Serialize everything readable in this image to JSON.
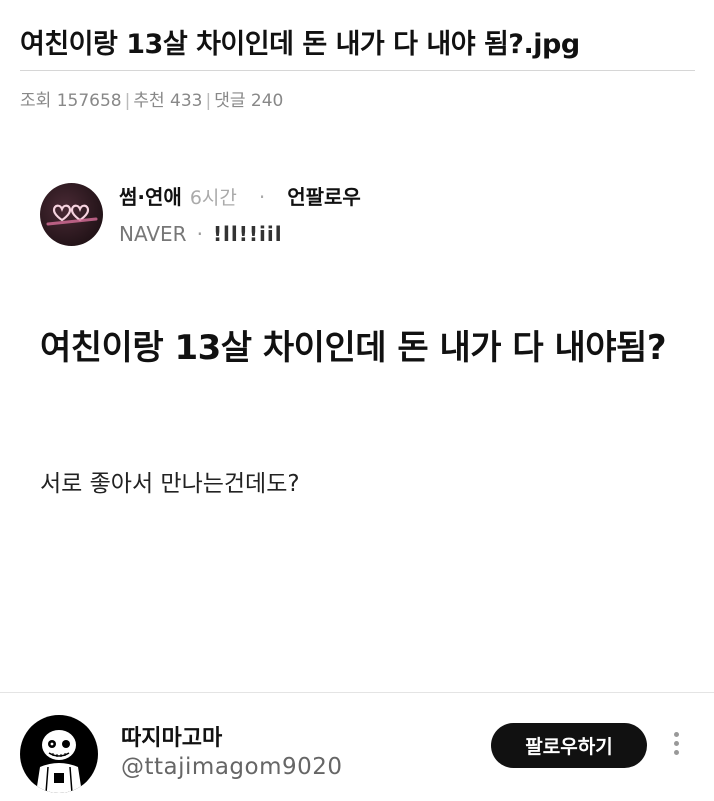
{
  "title": "여친이랑 13살 차이인데 돈 내가 다 내야 됨?.jpg",
  "meta": {
    "views_label": "조회",
    "views": "157658",
    "recommend_label": "추천",
    "recommend": "433",
    "comments_label": "댓글",
    "comments": "240"
  },
  "post": {
    "category": "썸·연애",
    "time": "6시간",
    "unfollow": "언팔로우",
    "source": "NAVER",
    "nickname": "!ll!!iil",
    "title": "여친이랑 13살 차이인데 돈 내가 다 내야됨?",
    "body": "서로 좋아서 만나는건데도?"
  },
  "footer": {
    "name": "따지마고마",
    "handle": "@ttajimagom9020",
    "follow_label": "팔로우하기"
  },
  "colors": {
    "button_bg": "#111111",
    "muted_text": "#888888"
  }
}
